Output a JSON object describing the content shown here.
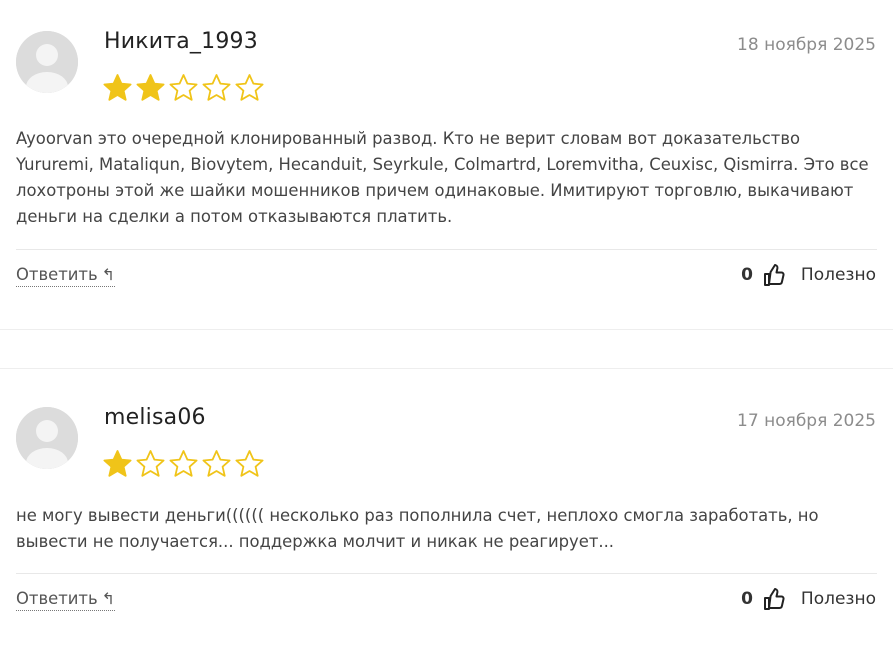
{
  "reviews": [
    {
      "author": "Никита_1993",
      "date": "18 ноября 2025",
      "rating": 2,
      "max_rating": 5,
      "text": "Ayoorvan это очередной клонированный развод. Кто не верит словам вот доказательство Yururemi, Mataliqun, Biovytem, Hecanduit, Seyrkule, Colmartrd, Loremvitha, Ceuxisc, Qismirra. Это все лохотроны этой же шайки мошенников причем одинаковые. Имитируют торговлю, выкачивают деньги на сделки а потом отказываются платить.",
      "reply_label": "Ответить",
      "likes": "0",
      "helpful_label": "Полезно"
    },
    {
      "author": "melisa06",
      "date": "17 ноября 2025",
      "rating": 1,
      "max_rating": 5,
      "text": "не могу вывести деньги(((((( несколько раз пополнила счет, неплохо смогла заработать, но вывести не получается... поддержка молчит и никак не реагирует...",
      "reply_label": "Ответить",
      "likes": "0",
      "helpful_label": "Полезно"
    }
  ],
  "icons": {
    "avatar": "user-avatar-icon",
    "star_filled": "star-filled-icon",
    "star_empty": "star-outline-icon",
    "reply": "reply-arrow-icon",
    "thumb": "thumbs-up-icon"
  },
  "colors": {
    "star": "#f0c419",
    "text": "#444444",
    "date": "#8c8c8c",
    "avatar_bg": "#dcdcdc"
  }
}
